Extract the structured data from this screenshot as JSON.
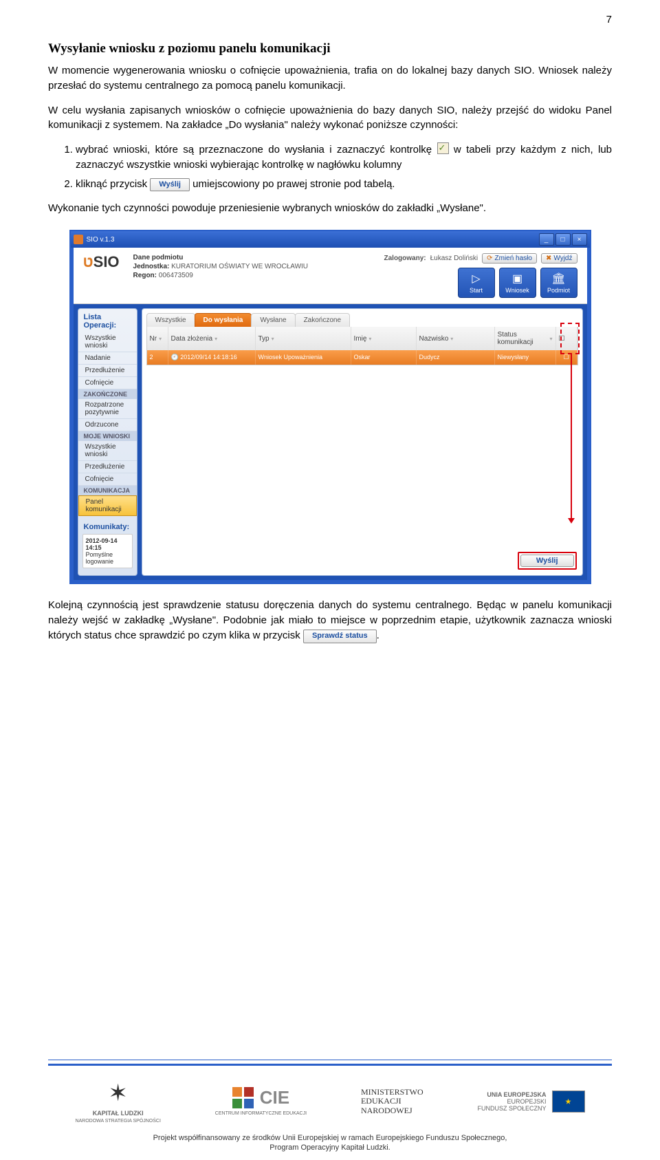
{
  "page_number": "7",
  "heading": "Wysyłanie wniosku z poziomu panelu komunikacji",
  "para1": "W momencie wygenerowania wniosku o cofnięcie upoważnienia, trafia on do lokalnej bazy danych SIO. Wniosek należy przesłać do systemu centralnego za pomocą panelu komunikacji.",
  "para2": "W celu wysłania zapisanych wniosków o cofnięcie upoważnienia do bazy danych SIO, należy przejść do widoku Panel komunikacji z systemem. Na zakładce „Do wysłania\" należy wykonać poniższe czynności:",
  "step1a": "wybrać wnioski, które są przeznaczone do wysłania i zaznaczyć kontrolkę ",
  "step1b": " w tabeli przy każdym z nich, lub zaznaczyć wszystkie wnioski wybierając kontrolkę w nagłówku kolumny",
  "step2a": "kliknąć przycisk ",
  "step2b": " umiejscowiony po prawej stronie pod tabelą.",
  "btn_wyslij": "Wyślij",
  "para3": "Wykonanie tych czynności powoduje przeniesienie wybranych wniosków do zakładki „Wysłane\".",
  "screenshot": {
    "title": "SIO v.1.3",
    "logo": "SIO",
    "hdr_labels": {
      "dane": "Dane podmiotu",
      "jednostka_k": "Jednostka:",
      "jednostka_v": "KURATORIUM OŚWIATY WE WROCŁAWIU",
      "regon_k": "Regon:",
      "regon_v": "006473509",
      "zalog": "Zalogowany:",
      "user": "Łukasz Doliński",
      "zmien": "Zmień hasło",
      "wyjdz": "Wyjdź",
      "start": "Start",
      "wniosek": "Wniosek",
      "podmiot": "Podmiot"
    },
    "side": {
      "h1": "Lista Operacji:",
      "items1": [
        "Wszystkie wnioski",
        "Nadanie",
        "Przedłużenie",
        "Cofnięcie"
      ],
      "grp1": "ZAKOŃCZONE",
      "items2": [
        "Rozpatrzone pozytywnie",
        "Odrzucone"
      ],
      "grp2": "MOJE WNIOSKI",
      "items3": [
        "Wszystkie wnioski",
        "Przedłużenie",
        "Cofnięcie"
      ],
      "grp3": "KOMUNIKACJA",
      "sel": "Panel komunikacji",
      "h2": "Komunikaty:",
      "kom_dt": "2012-09-14 14:15",
      "kom_tx": "Pomyślne logowanie"
    },
    "tabs": [
      "Wszystkie",
      "Do wysłania",
      "Wysłane",
      "Zakończone"
    ],
    "cols": [
      "Nr",
      "Data złożenia",
      "Typ",
      "Imię",
      "Nazwisko",
      "Status komunikacji"
    ],
    "row": {
      "nr": "2",
      "dt": "2012/09/14 14:18:16",
      "tp": "Wniosek Upoważnienia",
      "im": "Oskar",
      "nz": "Dudycz",
      "st": "Niewysłany"
    },
    "send": "Wyślij"
  },
  "para4": "Kolejną czynnością jest sprawdzenie statusu doręczenia danych do systemu centralnego. Będąc w panelu komunikacji należy wejść w zakładkę „Wysłane\". Podobnie jak miało to miejsce w poprzednim etapie, użytkownik zaznacza wnioski których status chce sprawdzić po czym klika w przycisk ",
  "btn_sprawdz": "Sprawdź status",
  "period": ".",
  "footer": {
    "kl": "KAPITAŁ LUDZKI",
    "kl2": "NARODOWA STRATEGIA SPÓJNOŚCI",
    "cie": "CIE",
    "cie2": "CENTRUM INFORMATYCZNE EDUKACJI",
    "men1": "MINISTERSTWO",
    "men2": "EDUKACJI",
    "men3": "NARODOWEJ",
    "ue": "UNIA EUROPEJSKA",
    "ue2": "EUROPEJSKI",
    "ue3": "FUNDUSZ SPOŁECZNY",
    "line1": "Projekt współfinansowany ze środków Unii Europejskiej w ramach Europejskiego Funduszu Społecznego,",
    "line2": "Program Operacyjny Kapitał Ludzki."
  }
}
